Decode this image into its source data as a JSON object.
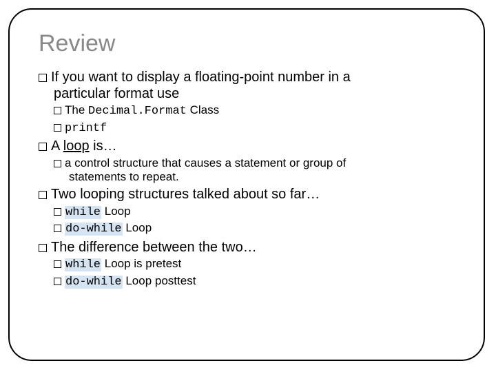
{
  "title": "Review",
  "p1_l1": "If you want to display a floating-point number in a",
  "p1_l2": "particular format use",
  "p1a_pre": "The ",
  "p1a_code": "Decimal.Format",
  "p1a_post": " Class",
  "p1b_code": "printf",
  "p2_pre": "A ",
  "p2_und": "loop",
  "p2_post": " is…",
  "p2a_l1": "a control structure that causes a statement or group of",
  "p2a_l2": "statements to repeat.",
  "p3": "Two looping structures talked about so far…",
  "p3a_code": "while",
  "p3a_post": " Loop",
  "p3b_code": "do-while",
  "p3b_post": " Loop",
  "p4": "The difference between the two…",
  "p4a_code": "while",
  "p4a_post": " Loop is pretest",
  "p4b_code": "do-while",
  "p4b_post": " Loop posttest"
}
